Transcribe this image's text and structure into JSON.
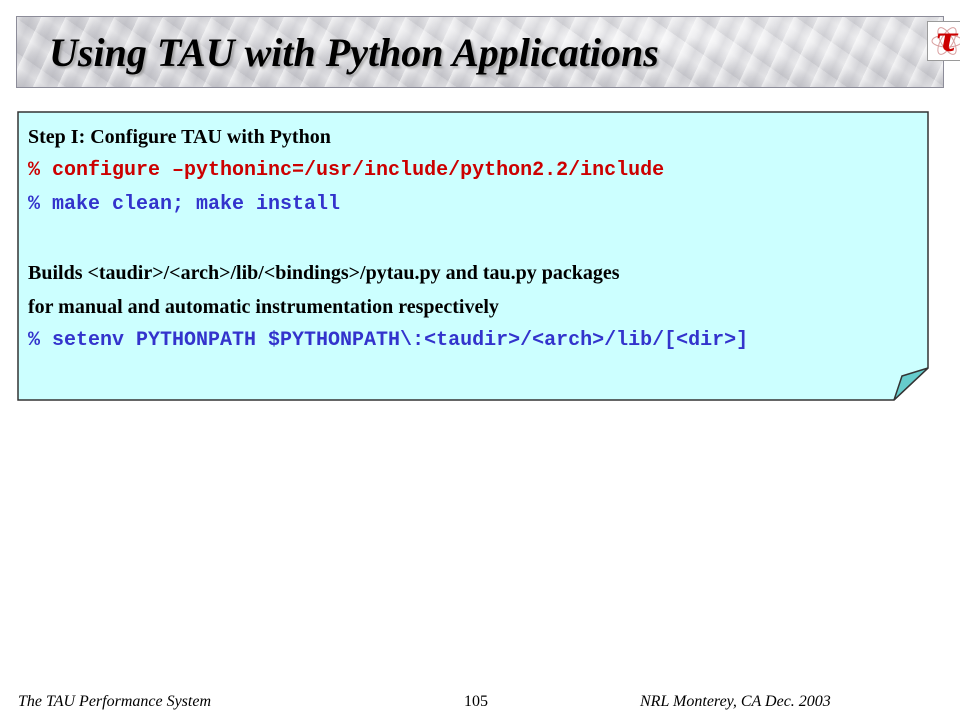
{
  "slide": {
    "title": "Using TAU with Python Applications",
    "logo_glyph": "τ",
    "logo_icon": "tau-logo-icon"
  },
  "content": {
    "heading": "Step I: Configure TAU with Python",
    "command_1": "% configure –pythoninc=/usr/include/python2.2/include",
    "command_2": "% make clean; make install",
    "body_line_1": "Builds <taudir>/<arch>/lib/<bindings>/pytau.py and tau.py packages",
    "body_line_2": "for manual and automatic instrumentation respectively",
    "command_3": "% setenv PYTHONPATH $PYTHONPATH\\:<taudir>/<arch>/lib/[<dir>]"
  },
  "footer": {
    "left": "The TAU Performance System",
    "page_number": "105",
    "right": "NRL Monterey, CA Dec. 2003"
  },
  "colors": {
    "card_fill": "#ccffff",
    "card_fold": "#66cccc",
    "command_red": "#cc0000",
    "command_blue": "#3333cc",
    "logo_red": "#cc0000"
  }
}
